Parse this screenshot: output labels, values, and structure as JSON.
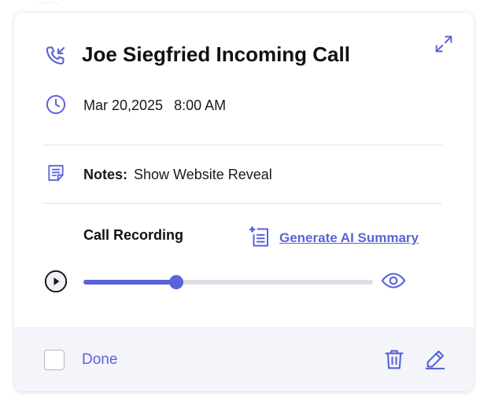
{
  "call": {
    "title": "Joe Siegfried Incoming Call",
    "date": "Mar 20,2025",
    "time": "8:00 AM",
    "notes_label": "Notes:",
    "notes_value": "Show Website Reveal"
  },
  "recording": {
    "title": "Call Recording",
    "ai_summary_link": "Generate AI Summary",
    "progress": 0.32
  },
  "footer": {
    "done_label": "Done",
    "done_checked": false
  },
  "colors": {
    "accent": "#5b63d8",
    "text": "#111111",
    "footer_bg": "#f4f5fb",
    "track": "#dedee6"
  },
  "icons": {
    "call": "phone-incoming-icon",
    "date": "clock-icon",
    "notes": "notes-icon",
    "ai": "ai-summary-icon",
    "play": "play-icon",
    "view": "eye-icon",
    "delete": "trash-icon",
    "edit": "pencil-icon",
    "expand": "expand-icon"
  }
}
